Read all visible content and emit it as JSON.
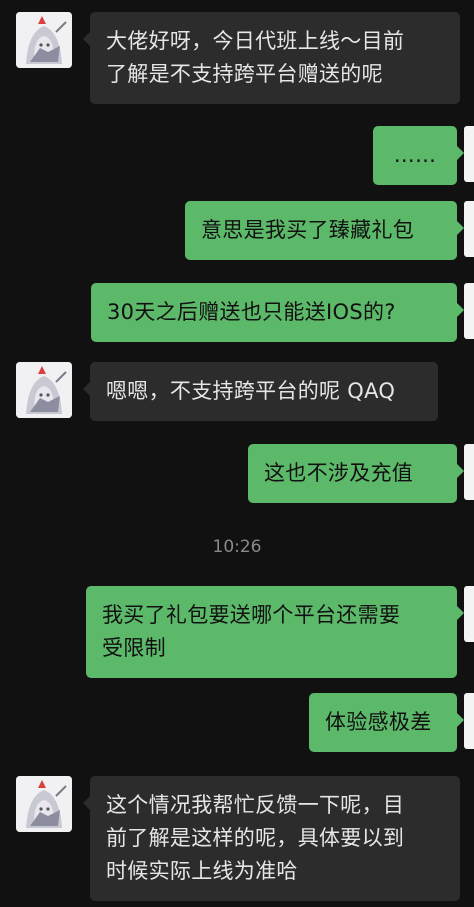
{
  "colors": {
    "background": "#111111",
    "incoming_bubble": "#2c2c2c",
    "outgoing_bubble": "#5cb96a",
    "timestamp": "#8a8a8a"
  },
  "messages": [
    {
      "sender": "other",
      "text": "大佬好呀，今日代班上线～目前\n了解是不支持跨平台赠送的呢"
    },
    {
      "sender": "self",
      "text": "……"
    },
    {
      "sender": "self",
      "text": "意思是我买了臻藏礼包"
    },
    {
      "sender": "self",
      "text": "30天之后赠送也只能送IOS的?"
    },
    {
      "sender": "other",
      "text": "嗯嗯，不支持跨平台的呢 QAQ"
    },
    {
      "sender": "self",
      "text": "这也不涉及充值"
    },
    {
      "sender": "self",
      "text": "我买了礼包要送哪个平台还需要\n受限制"
    },
    {
      "sender": "self",
      "text": "体验感极差"
    },
    {
      "sender": "other",
      "text": "这个情况我帮忙反馈一下呢，目\n前了解是这样的呢，具体要以到\n时候实际上线为准哈"
    }
  ],
  "timestamp": "10:26"
}
